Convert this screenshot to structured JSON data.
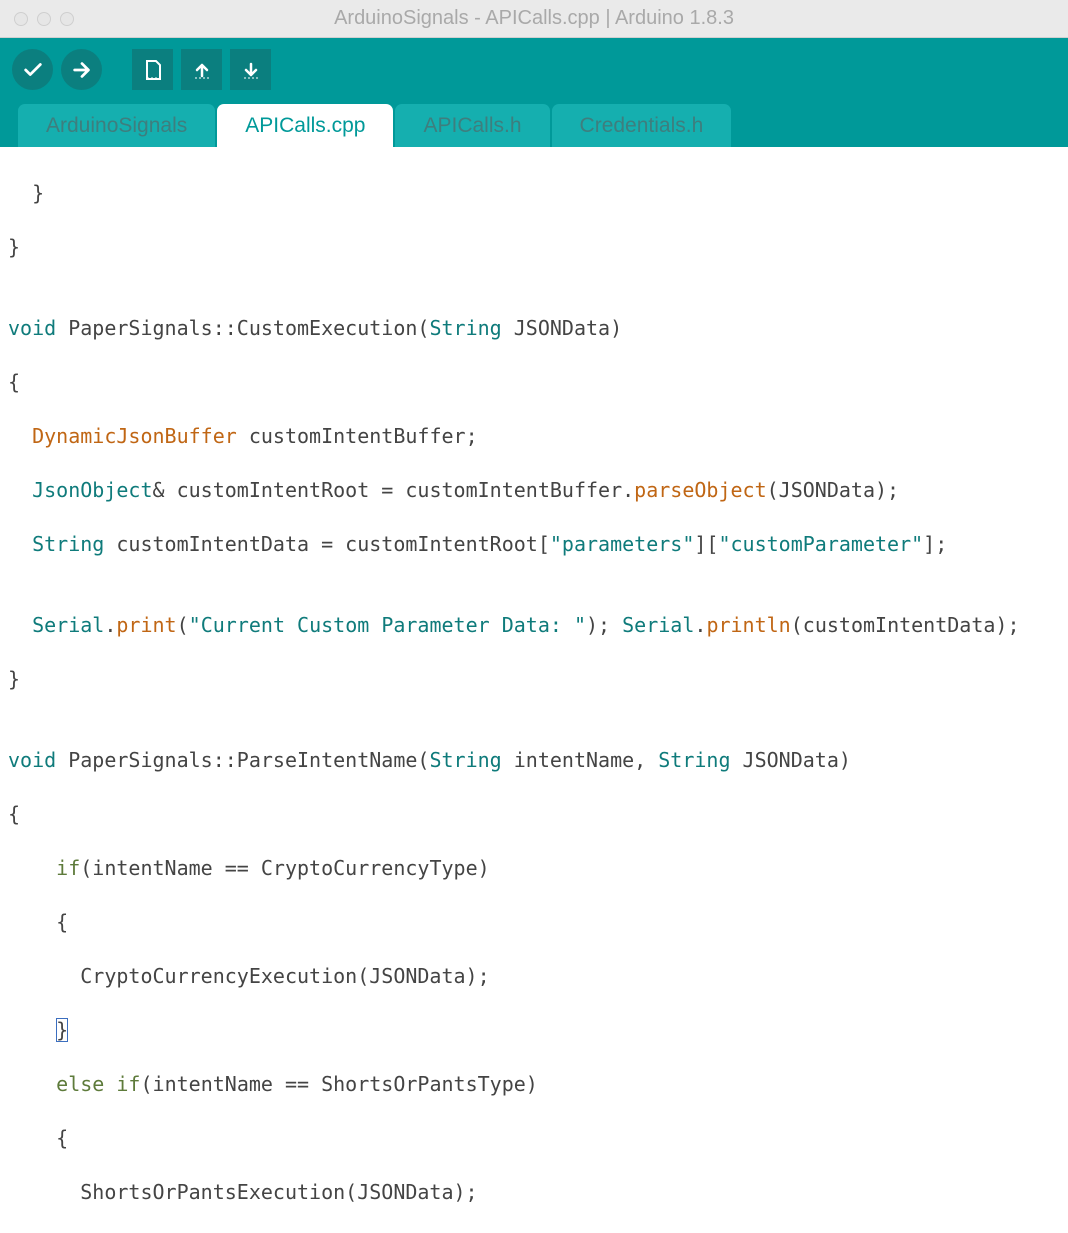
{
  "window": {
    "title": "ArduinoSignals - APICalls.cpp | Arduino 1.8.3"
  },
  "toolbar": {
    "verify": "Verify",
    "upload": "Upload",
    "new": "New",
    "open": "Open",
    "save": "Save"
  },
  "tabs": [
    {
      "label": "ArduinoSignals",
      "active": false
    },
    {
      "label": "APICalls.cpp",
      "active": true
    },
    {
      "label": "APICalls.h",
      "active": false
    },
    {
      "label": "Credentials.h",
      "active": false
    }
  ],
  "code": {
    "l1": "  }",
    "l2": "}",
    "l3": "",
    "l4a": "void",
    "l4b": " PaperSignals::CustomExecution(",
    "l4c": "String",
    "l4d": " JSONData)",
    "l5": "{",
    "l6a": "  ",
    "l6b": "DynamicJsonBuffer",
    "l6c": " customIntentBuffer;",
    "l7a": "  ",
    "l7b": "JsonObject",
    "l7c": "& customIntentRoot = customIntentBuffer.",
    "l7d": "parseObject",
    "l7e": "(JSONData);",
    "l8a": "  ",
    "l8b": "String",
    "l8c": " customIntentData = customIntentRoot[",
    "l8d": "\"parameters\"",
    "l8e": "][",
    "l8f": "\"customParameter\"",
    "l8g": "];",
    "l9": "",
    "l10a": "  ",
    "l10b": "Serial",
    "l10c": ".",
    "l10d": "print",
    "l10e": "(",
    "l10f": "\"Current Custom Parameter Data: \"",
    "l10g": "); ",
    "l10h": "Serial",
    "l10i": ".",
    "l10j": "println",
    "l10k": "(customIntentData);",
    "l11": "}",
    "l12": "",
    "l13a": "void",
    "l13b": " PaperSignals::ParseIntentName(",
    "l13c": "String",
    "l13d": " intentName, ",
    "l13e": "String",
    "l13f": " JSONData)",
    "l14": "{",
    "l15a": "    ",
    "l15b": "if",
    "l15c": "(intentName == CryptoCurrencyType)",
    "l16": "    {",
    "l17": "      CryptoCurrencyExecution(JSONData);",
    "l18a": "    ",
    "l18b": "}",
    "l19a": "    ",
    "l19b": "else",
    "l19c": " ",
    "l19d": "if",
    "l19e": "(intentName == ShortsOrPantsType)",
    "l20": "    {",
    "l21": "      ShortsOrPantsExecution(JSONData);"
  }
}
